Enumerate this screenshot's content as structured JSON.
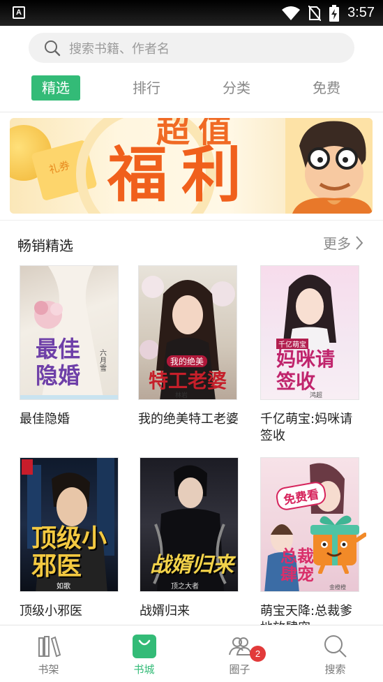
{
  "status_bar": {
    "time": "3:57",
    "app_badge": "A"
  },
  "search": {
    "placeholder": "搜索书籍、作者名"
  },
  "tabs": [
    {
      "label": "精选",
      "active": true
    },
    {
      "label": "排行",
      "active": false
    },
    {
      "label": "分类",
      "active": false
    },
    {
      "label": "免费",
      "active": false
    }
  ],
  "banner": {
    "title_top": "超值",
    "title_main": "福利",
    "ticket_text": "礼券"
  },
  "section": {
    "title": "畅销精选",
    "more_label": "更多"
  },
  "books": [
    {
      "title": "最佳隐婚",
      "cover_text": "最佳隐婚",
      "author": "六月雪"
    },
    {
      "title": "我的绝美特工老婆",
      "cover_text": "特工老婆",
      "cover_small": "我的绝美",
      "author": "林岩"
    },
    {
      "title": "千亿萌宝:妈咪请签收",
      "cover_text": "妈咪请签收",
      "cover_small": "千亿萌宝",
      "author": "鸿超"
    },
    {
      "title": "顶级小邪医",
      "cover_text": "顶级小邪医",
      "author": "如歌"
    },
    {
      "title": "战婿归来",
      "cover_text": "战婿归来",
      "author": "顶之大者"
    },
    {
      "title": "萌宝天降:总裁爹地放肆宠",
      "cover_text": "总裁放肆宠",
      "cover_sticker": "免费看",
      "author": "金橙橙"
    }
  ],
  "bottom_nav": [
    {
      "label": "书架",
      "icon": "bookshelf-icon",
      "active": false
    },
    {
      "label": "书城",
      "icon": "bookstore-bag-icon",
      "active": true
    },
    {
      "label": "圈子",
      "icon": "community-icon",
      "active": false,
      "badge": "2"
    },
    {
      "label": "搜索",
      "icon": "search-icon",
      "active": false
    }
  ],
  "colors": {
    "accent": "#33bb77",
    "badge": "#e23a3a",
    "banner_text": "#f0601c"
  }
}
